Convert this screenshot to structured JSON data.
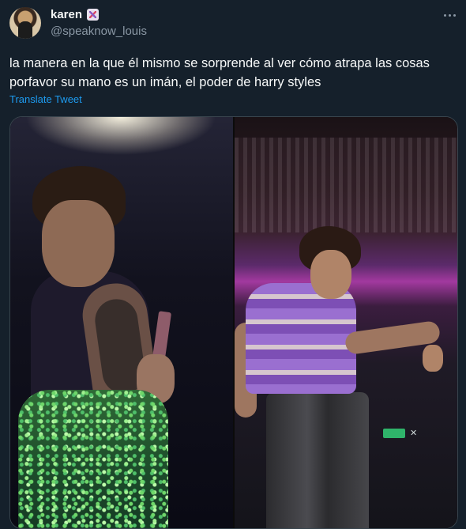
{
  "tweet": {
    "author": {
      "display_name": "karen",
      "handle": "@speaknow_louis",
      "badge_icon": "emoji-badge-icon"
    },
    "more_icon": "more-horizontal-icon",
    "text": "la manera en la que él mismo se sorprende al ver cómo atrapa las cosas\nporfavor su mano es un imán, el poder de harry styles",
    "translate_label": "Translate Tweet",
    "media": {
      "count": 2,
      "panels": [
        "left-video-frame",
        "right-video-frame"
      ]
    }
  },
  "colors": {
    "background": "#15202b",
    "text_primary": "#f7f9f9",
    "text_secondary": "#8b98a5",
    "link": "#1d9bf0",
    "border": "#38444d"
  }
}
